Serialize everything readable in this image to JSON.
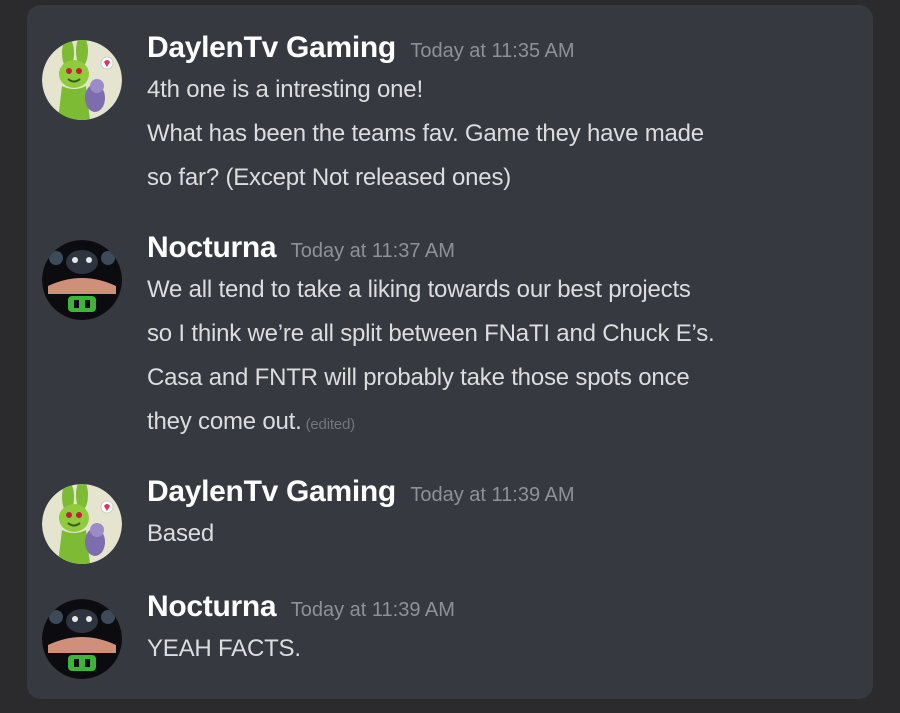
{
  "messages": [
    {
      "username": "DaylenTv Gaming",
      "timestamp": "Today at 11:35 AM",
      "avatar_icon": "green-bunny-avatar",
      "lines": [
        "4th one is a intresting one!",
        "What has been the teams fav. Game they have made",
        "so far? (Except Not released ones)"
      ]
    },
    {
      "username": "Nocturna",
      "timestamp": "Today at 11:37 AM",
      "avatar_icon": "dark-animatronic-avatar",
      "lines": [
        "We all tend to take a liking towards our best projects",
        "so I think we’re all split between FNaTI and Chuck E’s.",
        "Casa and FNTR will probably take those spots once",
        "they come out."
      ],
      "edited_label": "(edited)"
    },
    {
      "username": "DaylenTv Gaming",
      "timestamp": "Today at 11:39 AM",
      "avatar_icon": "green-bunny-avatar",
      "lines": [
        "Based"
      ]
    },
    {
      "username": "Nocturna",
      "timestamp": "Today at 11:39 AM",
      "avatar_icon": "dark-animatronic-avatar",
      "lines": [
        "YEAH FACTS."
      ]
    }
  ],
  "colors": {
    "background": "#2b2b2d",
    "panel": "#36393f",
    "username": "#ffffff",
    "message_text": "#dcddde",
    "timestamp": "#8e9297"
  }
}
